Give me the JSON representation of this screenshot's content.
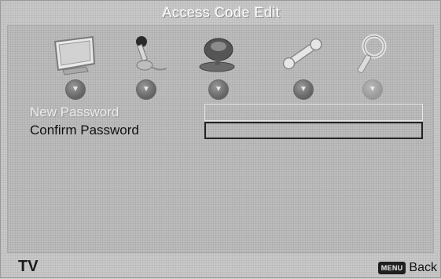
{
  "title": "Access Code Edit",
  "menu_icons": [
    {
      "name": "picture-icon",
      "selected": false
    },
    {
      "name": "audio-icon",
      "selected": false
    },
    {
      "name": "setup-icon",
      "selected": false
    },
    {
      "name": "tools-icon",
      "selected": false
    },
    {
      "name": "lock-icon",
      "selected": true
    }
  ],
  "form": {
    "new_password_label": "New Password",
    "new_password_value": "",
    "confirm_password_label": "Confirm Password",
    "confirm_password_value": ""
  },
  "footer": {
    "source": "TV",
    "menu_key": "MENU",
    "back_label": "Back"
  }
}
